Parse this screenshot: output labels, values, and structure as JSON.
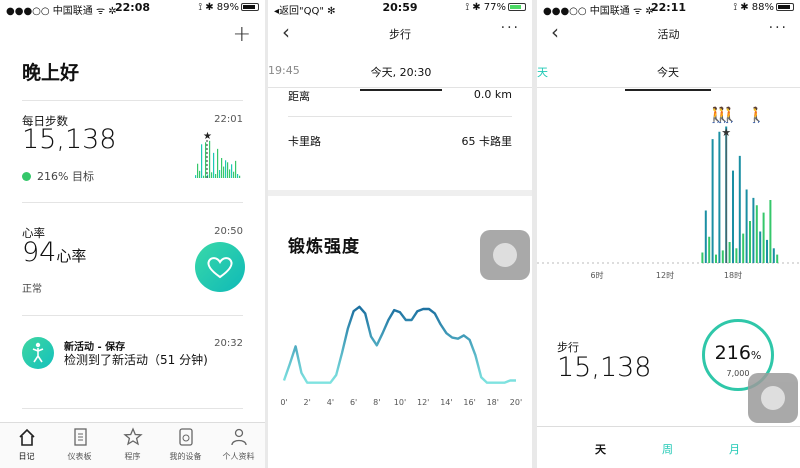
{
  "screen1": {
    "status": {
      "carrier": "●●●○○ 中国联通 ᯤ ✲",
      "time": "22:08",
      "right": "⟟ ✱ 89%",
      "battery_level": 0.89
    },
    "greeting": "晚上好",
    "steps": {
      "label": "每日步数",
      "time": "22:01",
      "value": "15,138",
      "goal_text": "216% 目标"
    },
    "heart": {
      "label": "心率",
      "time": "20:50",
      "value": "94",
      "unit": "心率",
      "status": "正常"
    },
    "activity": {
      "title": "新活动 - 保存",
      "time": "20:32",
      "text": "检测到了新活动（51 分钟)"
    },
    "nav": [
      "日记",
      "仪表板",
      "程序",
      "我的设备",
      "个人资料"
    ]
  },
  "screen2": {
    "status": {
      "carrier": "◂返回\"QQ\" ✻",
      "time": "20:59",
      "right": "⟟ ✱ 77%",
      "battery_level": 0.77
    },
    "title": "步行",
    "tabs": [
      "19:45",
      "今天, 20:30"
    ],
    "rows": [
      {
        "label": "距离",
        "value": "0.0 km"
      },
      {
        "label": "卡里路",
        "value": "65 卡路里"
      }
    ],
    "section_title": "锻炼强度",
    "chart_data": {
      "type": "line",
      "x_ticks": [
        "0'",
        "2'",
        "4'",
        "6'",
        "8'",
        "10'",
        "12'",
        "14'",
        "16'",
        "18'",
        "20'"
      ],
      "x": [
        0,
        0.5,
        1,
        1.5,
        2,
        2.5,
        3,
        3.5,
        4,
        4.5,
        5,
        5.5,
        6,
        6.5,
        7,
        7.5,
        8,
        8.5,
        9,
        9.5,
        10,
        10.5,
        11,
        11.5,
        12,
        12.5,
        13,
        13.5,
        14,
        14.5,
        15,
        15.5,
        16,
        16.5,
        17,
        17.5,
        18,
        18.5,
        19,
        19.5,
        20
      ],
      "values": [
        5,
        20,
        36,
        12,
        3,
        3,
        3,
        3,
        3,
        10,
        30,
        52,
        68,
        72,
        66,
        45,
        37,
        48,
        60,
        69,
        67,
        60,
        60,
        68,
        70,
        70,
        66,
        56,
        48,
        44,
        43,
        46,
        42,
        28,
        8,
        3,
        3,
        3,
        3,
        5,
        5
      ],
      "ylim": [
        0,
        80
      ]
    }
  },
  "screen3": {
    "status": {
      "carrier": "●●●○○ 中国联通 ᯤ ✲",
      "time": "22:11",
      "right": "⟟ ✱ 88%",
      "battery_level": 0.88
    },
    "title": "活动",
    "tabs": [
      "天",
      "今天"
    ],
    "chart_data": {
      "type": "bar",
      "x_ticks": [
        "6时",
        "12时",
        "18时"
      ],
      "hours": [
        15.3,
        15.6,
        15.9,
        16.2,
        16.5,
        16.8,
        17.1,
        17.4,
        17.7,
        18.0,
        18.3,
        18.6,
        18.9,
        19.2,
        19.5,
        19.8,
        20.1,
        20.4,
        20.7,
        21.0,
        21.3,
        21.6,
        21.9
      ],
      "values": [
        10,
        50,
        25,
        118,
        8,
        125,
        12,
        130,
        20,
        88,
        14,
        102,
        28,
        70,
        40,
        62,
        55,
        30,
        48,
        22,
        60,
        14,
        8
      ],
      "ylim": [
        0,
        140
      ]
    },
    "steps_label": "步行",
    "steps_value": "15,138",
    "percent": "216",
    "percent_unit": "%",
    "goal": "7,000",
    "bottom_tabs": [
      "天",
      "周",
      "月"
    ]
  },
  "colors": {
    "accent": "#1ec8b4",
    "green": "#35c76a",
    "teal_dark": "#1b8fa3"
  }
}
